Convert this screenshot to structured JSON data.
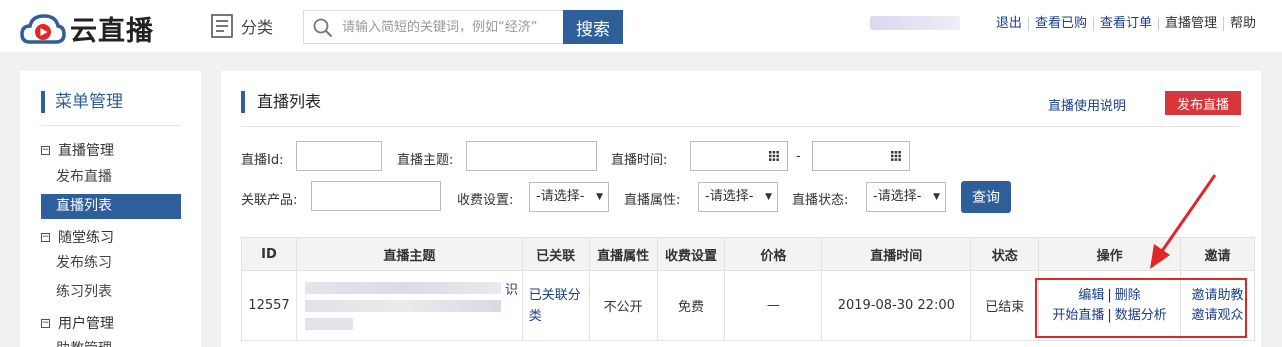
{
  "header": {
    "logo_text": "云直播",
    "category_label": "分类",
    "search_placeholder": "请输入简短的关键词，例如“经济”",
    "search_button": "搜索",
    "links": [
      "退出",
      "查看已购",
      "查看订单",
      "直播管理",
      "帮助"
    ],
    "colors": {
      "primary": "#2f5f9a",
      "danger": "#d9363b",
      "logo_red": "#e02727"
    }
  },
  "sidebar": {
    "title": "菜单管理",
    "groups": [
      {
        "label": "直播管理",
        "toggle": "⊟",
        "items": [
          "发布直播",
          "直播列表"
        ]
      },
      {
        "label": "随堂练习",
        "toggle": "⊟",
        "items": [
          "发布练习",
          "练习列表"
        ]
      },
      {
        "label": "用户管理",
        "toggle": "⊟",
        "items": [
          "助教管理"
        ]
      }
    ],
    "active_item": "直播列表"
  },
  "main": {
    "title": "直播列表",
    "help_link": "直播使用说明",
    "publish_button": "发布直播",
    "filters": {
      "live_id_label": "直播Id:",
      "topic_label": "直播主题:",
      "time_label": "直播时间:",
      "time_separator": "-",
      "product_label": "关联产品:",
      "fee_label": "收费设置:",
      "fee_value": "-请选择-",
      "attr_label": "直播属性:",
      "attr_value": "-请选择-",
      "status_label": "直播状态:",
      "status_value": "-请选择-",
      "query_button": "查询"
    },
    "table": {
      "headers": [
        "ID",
        "直播主题",
        "已关联",
        "直播属性",
        "收费设置",
        "价格",
        "直播时间",
        "状态",
        "操作",
        "邀请"
      ],
      "rows": [
        {
          "id": "12557",
          "topic_visible_char": "识",
          "linked": "已关联分类",
          "attr": "不公开",
          "fee": "免费",
          "price": "—",
          "time": "2019-08-30 22:00",
          "status": "已结束",
          "ops": [
            "编辑",
            "删除",
            "开始直播",
            "数据分析"
          ],
          "invite": [
            "邀请助教",
            "邀请观众"
          ]
        }
      ]
    }
  }
}
